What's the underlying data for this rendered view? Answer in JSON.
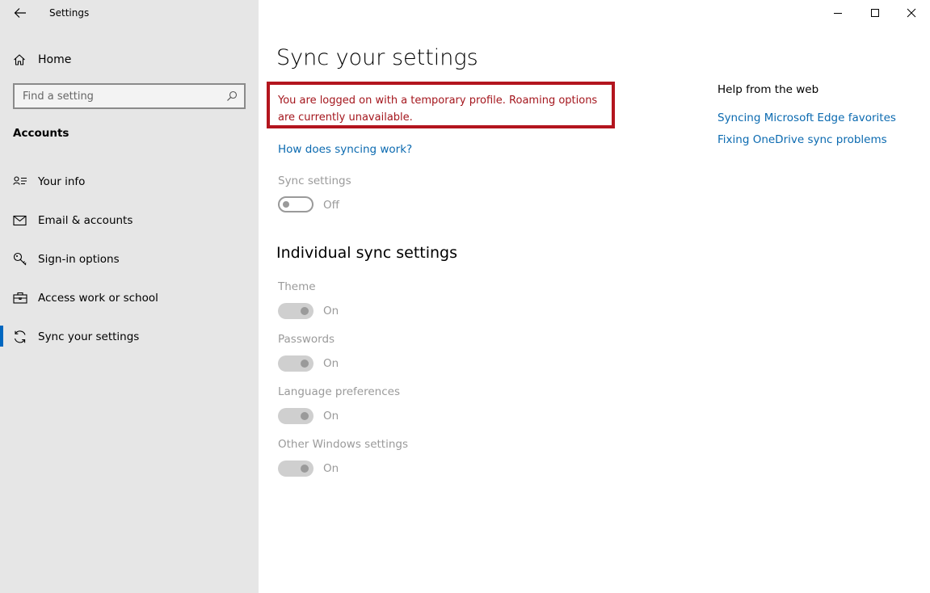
{
  "window": {
    "title": "Settings",
    "controls": [
      "minimize",
      "maximize",
      "close"
    ]
  },
  "sidebar": {
    "home_label": "Home",
    "search_placeholder": "Find a setting",
    "section_title": "Accounts",
    "items": [
      {
        "label": "Your info",
        "icon": "person-card-icon"
      },
      {
        "label": "Email & accounts",
        "icon": "mail-icon"
      },
      {
        "label": "Sign-in options",
        "icon": "key-icon"
      },
      {
        "label": "Access work or school",
        "icon": "briefcase-icon"
      },
      {
        "label": "Sync your settings",
        "icon": "sync-icon",
        "selected": true
      }
    ]
  },
  "main": {
    "title": "Sync your settings",
    "alert_text": "You are logged on with a temporary profile. Roaming options are currently unavailable.",
    "how_link": "How does syncing work?",
    "sync_settings": {
      "label": "Sync settings",
      "state": "Off"
    },
    "individual_title": "Individual sync settings",
    "individual": [
      {
        "label": "Theme",
        "state": "On"
      },
      {
        "label": "Passwords",
        "state": "On"
      },
      {
        "label": "Language preferences",
        "state": "On"
      },
      {
        "label": "Other Windows settings",
        "state": "On"
      }
    ]
  },
  "help": {
    "title": "Help from the web",
    "links": [
      "Syncing Microsoft Edge favorites",
      "Fixing OneDrive sync problems"
    ]
  },
  "colors": {
    "sidebar_bg": "#e6e6e6",
    "accent": "#0067c0",
    "link": "#0b6ab0",
    "alert_border": "#b3151e",
    "alert_text": "#a4161d",
    "disabled_text": "#9a9a9a"
  }
}
